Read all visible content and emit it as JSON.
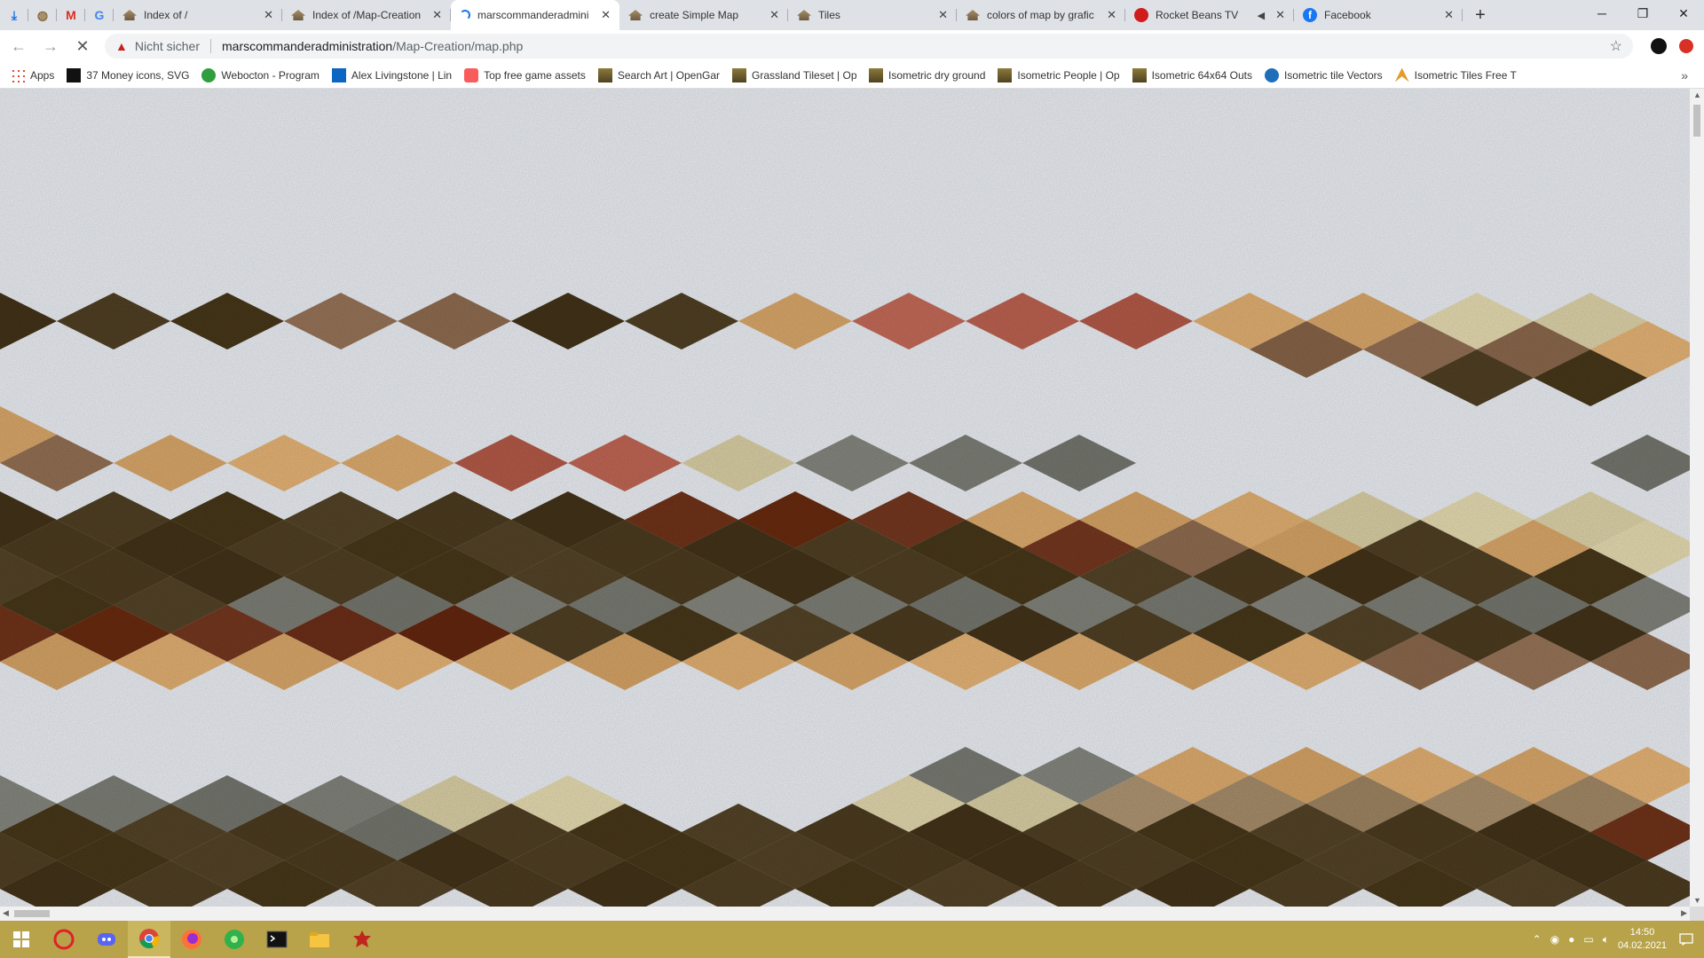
{
  "browser": {
    "pinned_tabs": [
      {
        "icon": "download-icon"
      },
      {
        "icon": "site-icon"
      },
      {
        "icon": "gmail-icon"
      },
      {
        "icon": "google-icon"
      }
    ],
    "tabs": [
      {
        "title": "Index of /",
        "icon": "house-icon",
        "active": false
      },
      {
        "title": "Index of /Map-Creation",
        "icon": "house-icon",
        "active": false
      },
      {
        "title": "marscommanderadmini",
        "icon": "loading-icon",
        "active": true
      },
      {
        "title": "create Simple Map",
        "icon": "house-icon",
        "active": false
      },
      {
        "title": "Tiles",
        "icon": "house-icon",
        "active": false
      },
      {
        "title": "colors of map by grafic",
        "icon": "house-icon",
        "active": false
      },
      {
        "title": "Rocket Beans TV",
        "icon": "rocketbeans-icon",
        "active": false,
        "muted": true
      },
      {
        "title": "Facebook",
        "icon": "facebook-icon",
        "active": false
      }
    ],
    "new_tab_label": "+",
    "window_controls": {
      "minimize": "─",
      "maximize": "❐",
      "close": "✕"
    }
  },
  "toolbar": {
    "security_text": "Nicht sicher",
    "url_host": "marscommanderadministration",
    "url_path": "/Map-Creation/map.php"
  },
  "bookmarks": [
    {
      "label": "Apps",
      "icon": "apps-grid-icon"
    },
    {
      "label": "37 Money icons, SVG",
      "icon": "black-square-icon"
    },
    {
      "label": "Webocton - Program",
      "icon": "green-circle-icon"
    },
    {
      "label": "Alex Livingstone | Lin",
      "icon": "linkedin-icon"
    },
    {
      "label": "Top free game assets",
      "icon": "itchio-icon"
    },
    {
      "label": "Search Art | OpenGar",
      "icon": "opengameart-icon"
    },
    {
      "label": "Grassland Tileset | Op",
      "icon": "opengameart-icon"
    },
    {
      "label": "Isometric dry ground",
      "icon": "opengameart-icon"
    },
    {
      "label": "Isometric People | Op",
      "icon": "opengameart-icon"
    },
    {
      "label": "Isometric 64x64 Outs",
      "icon": "opengameart-icon"
    },
    {
      "label": "Isometric tile Vectors",
      "icon": "vector-icon"
    },
    {
      "label": "Isometric Tiles Free T",
      "icon": "craftpix-icon"
    }
  ],
  "map": {
    "background_color": "#e8ebef",
    "tile_colors": {
      "snow": "#e6e9ee",
      "darkdirt": "#4a3a1f",
      "rock": "#8c6a4f",
      "sand": "#d9a86c",
      "clay": "#b8604f",
      "pale": "#d9cfa6",
      "gray": "#7a7c74",
      "redsoil": "#6a2e16",
      "lightbrown": "#a38a68"
    }
  },
  "taskbar": {
    "icons": [
      "windows-start-icon",
      "opera-icon",
      "discord-icon",
      "chrome-icon",
      "firefox-icon",
      "green-app-icon",
      "terminal-icon",
      "file-explorer-icon",
      "game-app-icon"
    ],
    "time": "14:50",
    "date": "04.02.2021"
  }
}
